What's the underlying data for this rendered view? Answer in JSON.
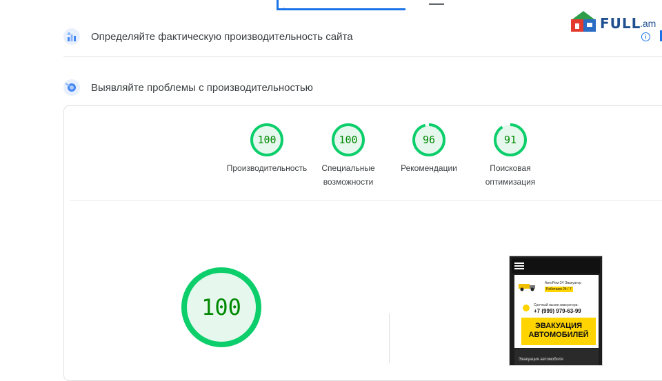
{
  "sections": [
    {
      "title": "Определяйте фактическую производительность сайта",
      "icon": "field-data-icon"
    },
    {
      "title": "Выявляйте проблемы с производительностью",
      "icon": "lab-diagnostics-icon"
    }
  ],
  "logo": {
    "text": "FULL",
    "suffix": ".am"
  },
  "info_glyph": "i",
  "colors": {
    "pass": "#0cce6b",
    "pass_bg": "#e6f8ee",
    "pass_text": "#008800",
    "accent": "#1a73e8"
  },
  "scores": [
    {
      "value": 100,
      "label_lines": [
        "Производительность"
      ]
    },
    {
      "value": 100,
      "label_lines": [
        "Специальные",
        "возможности"
      ]
    },
    {
      "value": 96,
      "label_lines": [
        "Рекомендации"
      ]
    },
    {
      "value": 91,
      "label_lines": [
        "Поисковая",
        "оптимизация"
      ]
    }
  ],
  "main_score": {
    "value": 100
  },
  "phone_preview": {
    "brand": "АвтоРем-24 Эвакуатор",
    "badge": "Работаем 24 / 7",
    "call_caption": "Срочный вызов эвакуатора:",
    "phone_number": "+7 (999) 979-63-99",
    "banner_line1": "ЭВАКУАЦИЯ",
    "banner_line2": "АВТОМОБИЛЕЙ",
    "footer": "Эвакуация автомобиля"
  }
}
